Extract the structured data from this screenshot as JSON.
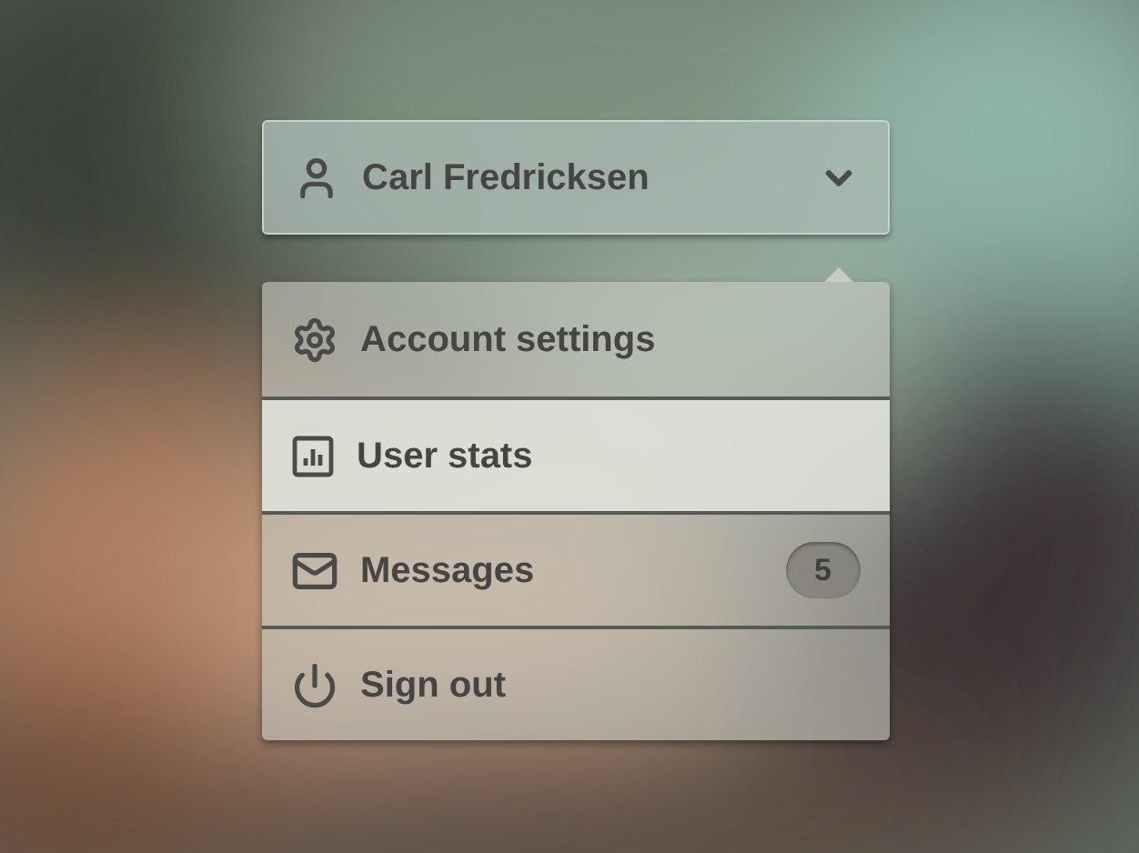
{
  "user_menu": {
    "name": "Carl Fredricksen",
    "expanded": true
  },
  "menu_items": [
    {
      "kind": "settings",
      "label": "Account settings",
      "selected": false
    },
    {
      "kind": "stats",
      "label": "User stats",
      "selected": true
    },
    {
      "kind": "messages",
      "label": "Messages",
      "selected": false,
      "badge": "5"
    },
    {
      "kind": "signout",
      "label": "Sign out",
      "selected": false
    }
  ]
}
